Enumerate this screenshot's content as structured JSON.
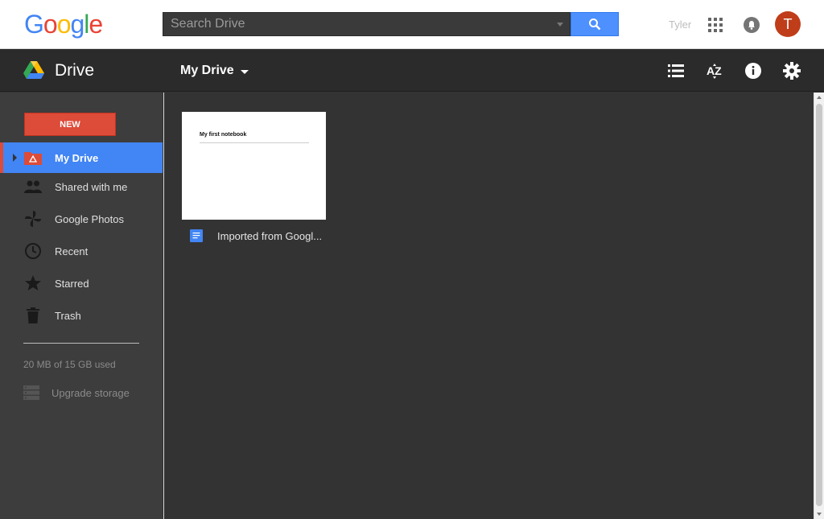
{
  "header": {
    "logo_letters": [
      "G",
      "o",
      "o",
      "g",
      "l",
      "e"
    ],
    "logo_colors": [
      "#4285f4",
      "#ea4335",
      "#fbbc05",
      "#4285f4",
      "#34a853",
      "#ea4335"
    ],
    "search_placeholder": "Search Drive",
    "user_name": "Tyler",
    "avatar_letter": "T",
    "avatar_color": "#c03d1a"
  },
  "navbar": {
    "app_title": "Drive",
    "breadcrumb": "My Drive",
    "icons": [
      "list-view-icon",
      "sort-az-icon",
      "info-icon",
      "settings-gear-icon"
    ]
  },
  "sidebar": {
    "new_button": "NEW",
    "items": [
      {
        "label": "My Drive",
        "icon": "my-drive-icon",
        "active": true
      },
      {
        "label": "Shared with me",
        "icon": "people-icon",
        "active": false
      },
      {
        "label": "Google Photos",
        "icon": "pinwheel-icon",
        "active": false
      },
      {
        "label": "Recent",
        "icon": "clock-icon",
        "active": false
      },
      {
        "label": "Starred",
        "icon": "star-icon",
        "active": false
      },
      {
        "label": "Trash",
        "icon": "trash-icon",
        "active": false
      }
    ],
    "storage_text": "20 MB of 15 GB used",
    "upgrade_text": "Upgrade storage"
  },
  "files": [
    {
      "name": "Imported from Googl...",
      "preview_title": "My first notebook",
      "type": "document-icon"
    }
  ],
  "colors": {
    "accent_blue": "#4285f4",
    "new_red": "#dd4b39"
  }
}
